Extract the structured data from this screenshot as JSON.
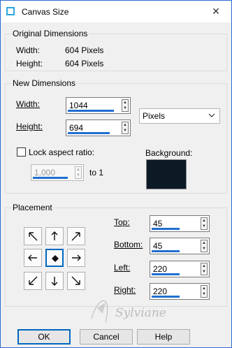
{
  "window": {
    "title": "Canvas Size",
    "close_glyph": "✕"
  },
  "original": {
    "group_label": "Original Dimensions",
    "width_label": "Width:",
    "width_value": "604 Pixels",
    "height_label": "Height:",
    "height_value": "604 Pixels"
  },
  "new": {
    "group_label": "New Dimensions",
    "width_label": "Width:",
    "width_value": "1044",
    "height_label": "Height:",
    "height_value": "694",
    "units": "Pixels",
    "lock_label": "Lock aspect ratio:",
    "ratio_value": "1,000",
    "ratio_suffix": "to 1",
    "background_label": "Background:",
    "background_color": "#0c1a26"
  },
  "placement": {
    "group_label": "Placement",
    "top_label": "Top:",
    "top_value": "45",
    "bottom_label": "Bottom:",
    "bottom_value": "45",
    "left_label": "Left:",
    "left_value": "220",
    "right_label": "Right:",
    "right_value": "220",
    "selected_anchor": "center"
  },
  "buttons": {
    "ok": "OK",
    "cancel": "Cancel",
    "help": "Help"
  },
  "watermark": "Sylviane"
}
